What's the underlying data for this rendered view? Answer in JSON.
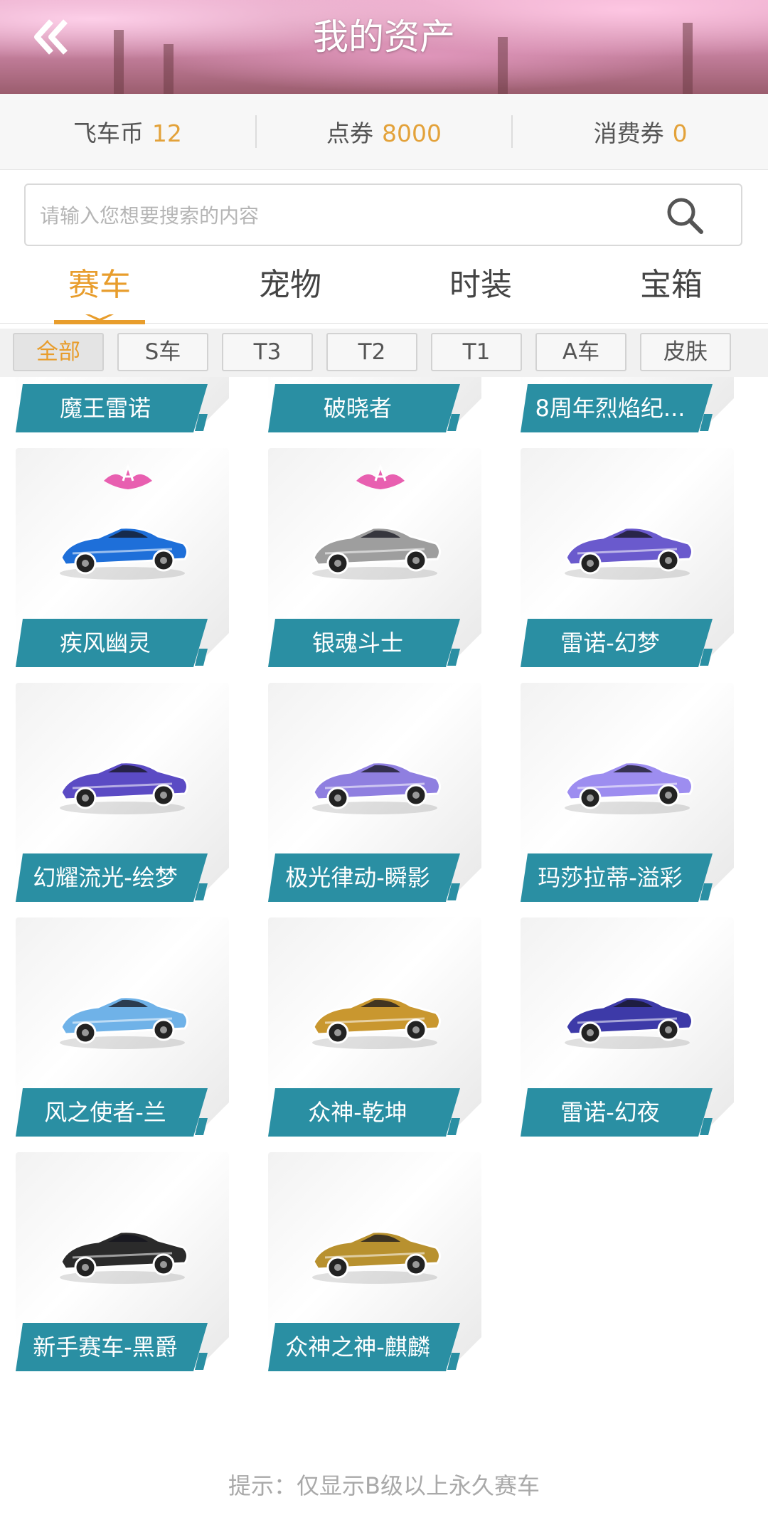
{
  "header": {
    "title": "我的资产",
    "back_icon": "double-chevron-left-icon"
  },
  "currencies": [
    {
      "label": "飞车币",
      "value": "12"
    },
    {
      "label": "点券",
      "value": "8000"
    },
    {
      "label": "消费券",
      "value": "0"
    }
  ],
  "search": {
    "placeholder": "请输入您想要搜索的内容",
    "icon": "search-icon"
  },
  "tabs": [
    {
      "label": "赛车",
      "active": true
    },
    {
      "label": "宠物",
      "active": false
    },
    {
      "label": "时装",
      "active": false
    },
    {
      "label": "宝箱",
      "active": false
    }
  ],
  "filters": [
    {
      "label": "全部",
      "active": true
    },
    {
      "label": "S车",
      "active": false
    },
    {
      "label": "T3",
      "active": false
    },
    {
      "label": "T2",
      "active": false
    },
    {
      "label": "T1",
      "active": false
    },
    {
      "label": "A车",
      "active": false
    },
    {
      "label": "皮肤",
      "active": false
    }
  ],
  "cars": [
    {
      "name": "魔王雷诺",
      "color": "#c62828",
      "badge": false
    },
    {
      "name": "破晓者",
      "color": "#455a64",
      "badge": false
    },
    {
      "name": "8周年烈焰纪...",
      "color": "#d32f2f",
      "badge": false
    },
    {
      "name": "疾风幽灵",
      "color": "#1e6fd9",
      "badge": true
    },
    {
      "name": "银魂斗士",
      "color": "#9e9e9e",
      "badge": true
    },
    {
      "name": "雷诺-幻梦",
      "color": "#6a5acd",
      "badge": false
    },
    {
      "name": "幻耀流光-绘梦",
      "color": "#5b4bc4",
      "badge": false
    },
    {
      "name": "极光律动-瞬影",
      "color": "#8f7fe0",
      "badge": false
    },
    {
      "name": "玛莎拉蒂-溢彩",
      "color": "#9d8df0",
      "badge": false
    },
    {
      "name": "风之使者-兰",
      "color": "#6fb2e8",
      "badge": false
    },
    {
      "name": "众神-乾坤",
      "color": "#c9972f",
      "badge": false
    },
    {
      "name": "雷诺-幻夜",
      "color": "#3d3aa8",
      "badge": false
    },
    {
      "name": "新手赛车-黑爵",
      "color": "#2b2b2b",
      "badge": false
    },
    {
      "name": "众神之神-麒麟",
      "color": "#b8912f",
      "badge": false
    }
  ],
  "hint": "提示：仅显示B级以上永久赛车",
  "colors": {
    "accent": "#e89d2c",
    "ribbon": "#2a8fa3",
    "badge_pink": "#e85fb0"
  }
}
